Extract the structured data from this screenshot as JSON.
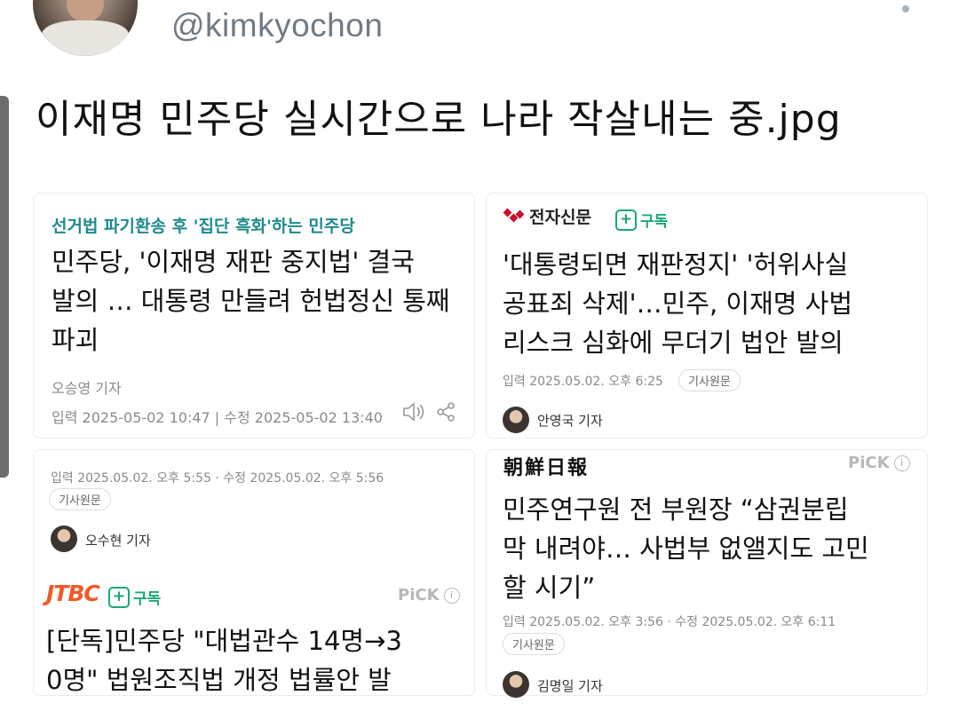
{
  "tweet": {
    "handle": "@kimkyochon",
    "text": "이재명 민주당 실시간으로 나라 작살내는 중.jpg"
  },
  "articles": {
    "top_left": {
      "kicker": "선거법 파기환송 후 '집단 흑화'하는 민주당",
      "headline_lines": [
        "민주당, '이재명 재판 중지법' 결국",
        "발의 … 대통령 만들려 헌법정신 통째",
        "파괴"
      ],
      "reporter": "오승영 기자",
      "dates": "입력 2025-05-02 10:47 | 수정 2025-05-02 13:40"
    },
    "top_right": {
      "publisher": "전자신문",
      "subscribe_label": "구독",
      "headline_lines": [
        "'대통령되면 재판정지' '허위사실",
        "공표죄 삭제'…민주, 이재명 사법",
        "리스크 심화에 무더기 법안 발의"
      ],
      "dates": "입력 2025.05.02. 오후 6:25",
      "original_label": "기사원문",
      "reporter": "안영국 기자"
    },
    "bottom_left": {
      "dates": "입력 2025.05.02. 오후 5:55 · 수정 2025.05.02. 오후 5:56",
      "original_label": "기사원문",
      "reporter": "오수현 기자",
      "next_publisher": "JTBC",
      "subscribe_label": "구독",
      "pick_label": "PiCK",
      "next_headline_lines": [
        "[단독]민주당 \"대법관수 14명→3",
        "0명\" 법원조직법 개정 법률안 발"
      ]
    },
    "bottom_right": {
      "publisher": "朝鮮日報",
      "pick_label": "PiCK",
      "headline_lines": [
        "민주연구원 전 부원장 “삼권분립",
        "막 내려야… 사법부 없앨지도 고민",
        "할 시기”"
      ],
      "dates": "입력 2025.05.02. 오후 3:56 · 수정 2025.05.02. 오후 6:11",
      "original_label": "기사원문",
      "reporter": "김명일 기자"
    }
  },
  "colors": {
    "kicker": "#1f8a8e",
    "subscribe": "#19a974",
    "jtbc": "#f05a28",
    "etnews": "#c8102e"
  },
  "icons": [
    "speaker-icon",
    "share-icon",
    "info-icon",
    "plus-icon"
  ]
}
